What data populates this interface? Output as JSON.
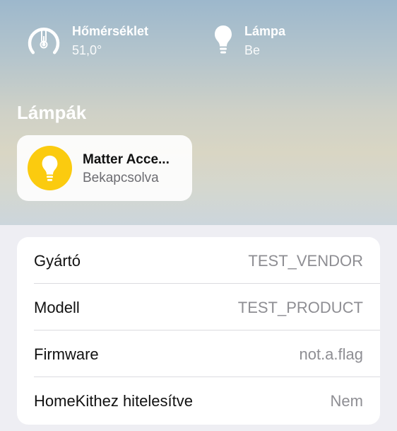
{
  "status": {
    "temperature": {
      "icon": "thermometer-gauge-icon",
      "title": "Hőmérséklet",
      "value": "51,0°",
      "gauge_fraction": 0.7
    },
    "lamp": {
      "icon": "lightbulb-icon",
      "title": "Lámpa",
      "value": "Be"
    }
  },
  "lamps_section": {
    "title": "Lámpák",
    "accessory": {
      "icon": "lightbulb-icon",
      "name": "Matter Acce...",
      "state": "Bekapcsolva",
      "icon_bg_color": "#fbcb0f"
    }
  },
  "info": {
    "rows": [
      {
        "label": "Gyártó",
        "value": "TEST_VENDOR"
      },
      {
        "label": "Modell",
        "value": "TEST_PRODUCT"
      },
      {
        "label": "Firmware",
        "value": "not.a.flag"
      },
      {
        "label": "HomeKithez hitelesítve",
        "value": "Nem"
      }
    ]
  },
  "colors": {
    "accent_yellow": "#fbcb0f",
    "secondary_text": "#8e8e93",
    "background": "#eeeef3"
  }
}
